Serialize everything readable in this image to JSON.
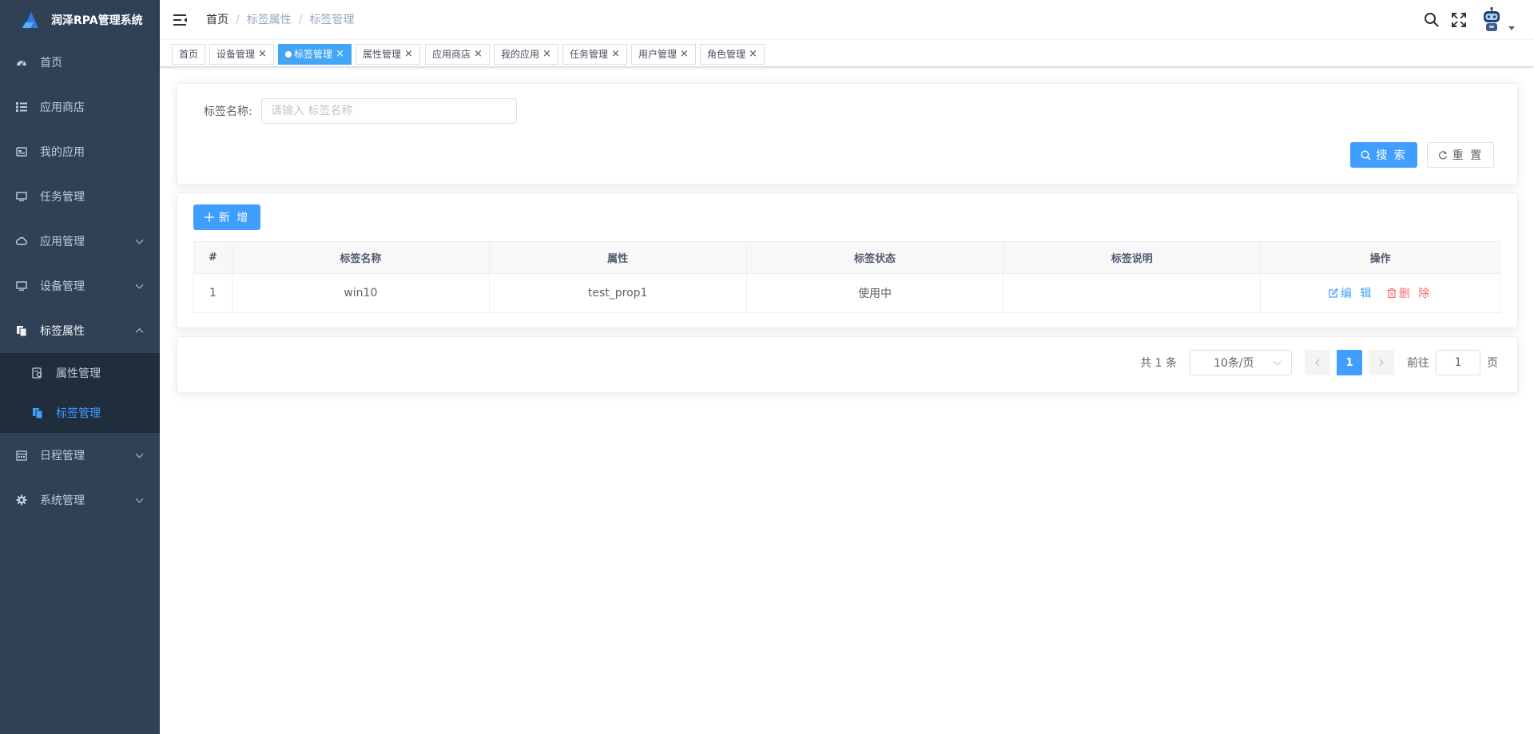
{
  "app": {
    "title": "润泽RPA管理系统"
  },
  "sidebar": {
    "items": [
      {
        "label": "首页",
        "icon": "dashboard-icon"
      },
      {
        "label": "应用商店",
        "icon": "list-icon"
      },
      {
        "label": "我的应用",
        "icon": "app-icon"
      },
      {
        "label": "任务管理",
        "icon": "monitor-icon"
      },
      {
        "label": "应用管理",
        "icon": "cloud-icon",
        "expandable": true
      },
      {
        "label": "设备管理",
        "icon": "monitor-icon",
        "expandable": true
      },
      {
        "label": "标签属性",
        "icon": "copy-icon",
        "expandable": true,
        "open": true
      },
      {
        "label": "日程管理",
        "icon": "calendar-icon",
        "expandable": true
      },
      {
        "label": "系统管理",
        "icon": "gear-icon",
        "expandable": true
      }
    ],
    "sub_items": [
      {
        "label": "属性管理",
        "icon": "edit-doc-icon"
      },
      {
        "label": "标签管理",
        "icon": "copy-icon",
        "active": true
      }
    ]
  },
  "breadcrumb": [
    "首页",
    "标签属性",
    "标签管理"
  ],
  "tags": [
    {
      "label": "首页",
      "closable": false
    },
    {
      "label": "设备管理",
      "closable": true
    },
    {
      "label": "标签管理",
      "closable": true,
      "active": true
    },
    {
      "label": "属性管理",
      "closable": true
    },
    {
      "label": "应用商店",
      "closable": true
    },
    {
      "label": "我的应用",
      "closable": true
    },
    {
      "label": "任务管理",
      "closable": true
    },
    {
      "label": "用户管理",
      "closable": true
    },
    {
      "label": "角色管理",
      "closable": true
    }
  ],
  "search": {
    "label": "标签名称:",
    "placeholder": "请输入 标签名称",
    "value": "",
    "search_label": "搜 索",
    "reset_label": "重 置"
  },
  "toolbar": {
    "add_label": "新 增"
  },
  "table": {
    "columns": [
      "#",
      "标签名称",
      "属性",
      "标签状态",
      "标签说明",
      "操作"
    ],
    "rows": [
      {
        "index": "1",
        "name": "win10",
        "prop": "test_prop1",
        "status": "使用中",
        "desc": ""
      }
    ],
    "edit_label": "编 辑",
    "delete_label": "删 除"
  },
  "pagination": {
    "total_text": "共 1 条",
    "page_size": "10条/页",
    "current_page": "1",
    "goto_label": "前往",
    "goto_value": "1",
    "page_suffix": "页"
  },
  "colors": {
    "sidebar_bg": "#304156",
    "primary": "#409eff",
    "danger": "#f56c6c",
    "active_tag": "#42a5f5"
  }
}
